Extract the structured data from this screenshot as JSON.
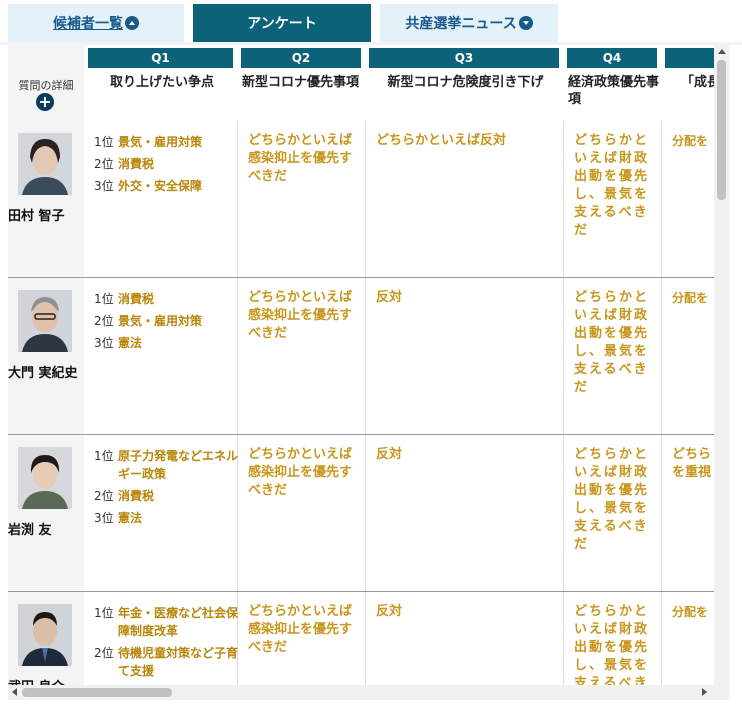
{
  "tabs": {
    "candidates": "候補者一覧",
    "survey": "アンケート",
    "news": "共産選挙ニュース"
  },
  "corner": {
    "label": "質問の詳細"
  },
  "questions": [
    {
      "q": "Q1",
      "text": "取り上げたい争点"
    },
    {
      "q": "Q2",
      "text": "新型コロナ優先事項"
    },
    {
      "q": "Q3",
      "text": "新型コロナ危険度引き下げ"
    },
    {
      "q": "Q4",
      "text": "経済政策優先事項"
    },
    {
      "q": "",
      "text": "「成長"
    }
  ],
  "candidates": [
    {
      "name": "田村 智子",
      "ranks": [
        {
          "n": "1位",
          "t": "景気・雇用対策"
        },
        {
          "n": "2位",
          "t": "消費税"
        },
        {
          "n": "3位",
          "t": "外交・安全保障"
        }
      ],
      "q2": "どちらかといえば感染抑止を優先すべきだ",
      "q3": "どちらかといえば反対",
      "q4": "どちらかといえば財政出動を優先し、景気を支えるべきだ",
      "q5": "分配を"
    },
    {
      "name": "大門 実紀史",
      "ranks": [
        {
          "n": "1位",
          "t": "消費税"
        },
        {
          "n": "2位",
          "t": "景気・雇用対策"
        },
        {
          "n": "3位",
          "t": "憲法"
        }
      ],
      "q2": "どちらかといえば感染抑止を優先すべきだ",
      "q3": "反対",
      "q4": "どちらかといえば財政出動を優先し、景気を支えるべきだ",
      "q5": "分配を"
    },
    {
      "name": "岩渕 友",
      "ranks": [
        {
          "n": "1位",
          "t": "原子力発電などエネルギー政策"
        },
        {
          "n": "2位",
          "t": "消費税"
        },
        {
          "n": "3位",
          "t": "憲法"
        }
      ],
      "q2": "どちらかといえば感染抑止を優先すべきだ",
      "q3": "反対",
      "q4": "どちらかといえば財政出動を優先し、景気を支えるべきだ",
      "q5": "どちら を重視"
    },
    {
      "name": "武田 良介",
      "ranks": [
        {
          "n": "1位",
          "t": "年金・医療など社会保障制度改革"
        },
        {
          "n": "2位",
          "t": "待機児童対策など子育て支援"
        }
      ],
      "q2": "どちらかといえば感染抑止を優先すべきだ",
      "q3": "反対",
      "q4": "どちらかといえば財政出動を優先し、景気を支えるべきだ",
      "q5": "分配を"
    }
  ],
  "colors": {
    "accent": "#0c6379",
    "answer": "#c8961c",
    "rank": "#b8860b"
  }
}
